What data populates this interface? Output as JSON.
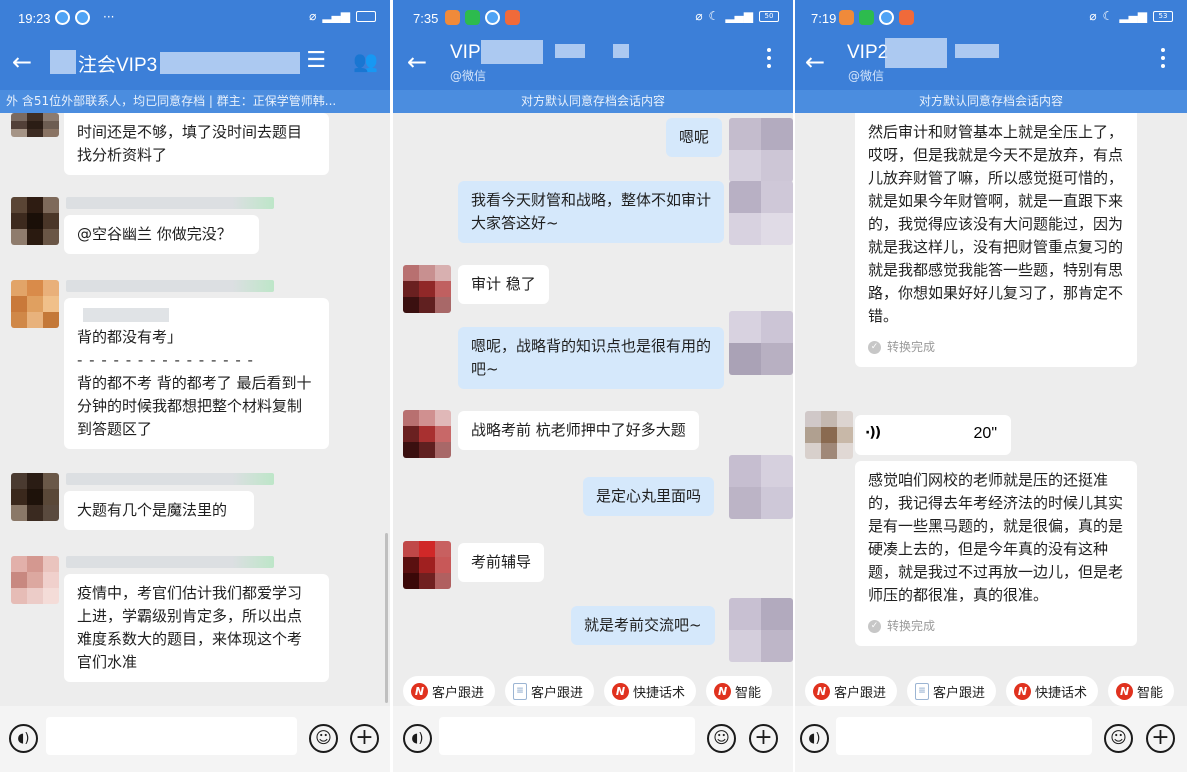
{
  "panel1": {
    "status": {
      "time": "19:23",
      "dots": "···"
    },
    "header": {
      "title": "注会VIP3",
      "notice": "外    含51位外部联系人，均已同意存档 | 群主：正保学管师韩..."
    },
    "messages": [
      {
        "text": "时间还是不够，填了没时间去题目找分析资料了"
      },
      {
        "text": "@空谷幽兰 你做完没？"
      },
      {
        "quote": "背的都没有考」",
        "dash": "- - - - - - - - - - - - - - -",
        "text": "背的都不考  背的都考了  最后看到十分钟的时候我都想把整个材料复制到答题区了"
      },
      {
        "text": "大题有几个是魔法里的"
      },
      {
        "text": "疫情中，考官们估计我们都爱学习上进，学霸级别肯定多，所以出点难度系数大的题目，来体现这个考官们水准"
      }
    ]
  },
  "panel2": {
    "status": {
      "time": "7:35",
      "battery": "50"
    },
    "header": {
      "title": "VIP",
      "subtitle": "@微信",
      "notice": "对方默认同意存档会话内容"
    },
    "messages": [
      {
        "text": "嗯呢"
      },
      {
        "text": "我看今天财管和战略，整体不如审计大家答这好~"
      },
      {
        "text": "审计 稳了"
      },
      {
        "text": "嗯呢，战略背的知识点也是很有用的吧~"
      },
      {
        "text": "战略考前 杭老师押中了好多大题"
      },
      {
        "text": "是定心丸里面吗"
      },
      {
        "text": "考前辅导"
      },
      {
        "text": "就是考前交流吧~"
      }
    ],
    "chips": [
      "客户跟进",
      "客户跟进",
      "快捷话术",
      "智能"
    ]
  },
  "panel3": {
    "status": {
      "time": "7:19",
      "battery": "53"
    },
    "header": {
      "title": "VIP2",
      "subtitle": "@微信",
      "notice": "对方默认同意存档会话内容"
    },
    "messages": [
      {
        "text": "然后审计和财管基本上就是全压上了，哎呀，但是我就是今天不是放弃，有点儿放弃财管了嘛，所以感觉挺可惜的，就是如果今年财管啊，就是一直跟下来的，我觉得应该没有大问题能过，因为就是我这样儿，没有把财管重点复习的就是我都感觉我能答一些题，特别有思路，你想如果好好儿复习了，那肯定不错。",
        "status": "转换完成"
      },
      {
        "voice_duration": "20\""
      },
      {
        "text": "感觉咱们网校的老师就是压的还挺准的，我记得去年考经济法的时候儿其实是有一些黑马题的，就是很偏，真的是硬凑上去的，但是今年真的没有这种题，就是我过不过再放一边儿，但是老师压的都很准，真的很准。",
        "status": "转换完成"
      }
    ],
    "chips": [
      "客户跟进",
      "客户跟进",
      "快捷话术",
      "智能"
    ]
  }
}
